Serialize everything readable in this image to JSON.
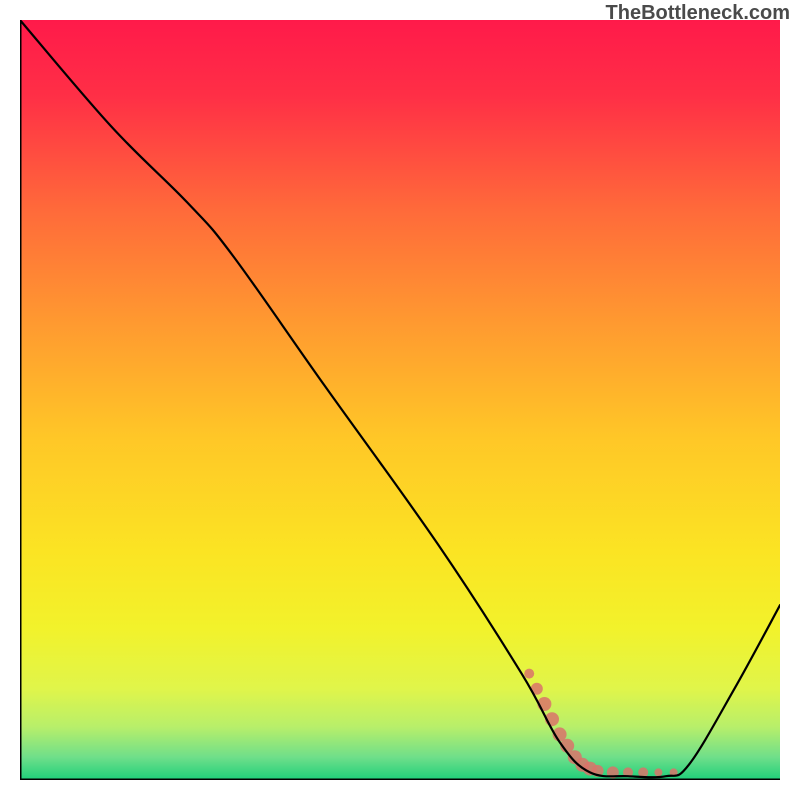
{
  "watermark": "TheBottleneck.com",
  "chart_data": {
    "type": "line",
    "title": "",
    "xlabel": "",
    "ylabel": "",
    "xlim": [
      0,
      100
    ],
    "ylim": [
      0,
      100
    ],
    "gradient_stops": [
      {
        "offset": 0.0,
        "color": "#ff1a4a"
      },
      {
        "offset": 0.1,
        "color": "#ff2f46"
      },
      {
        "offset": 0.25,
        "color": "#ff6a3a"
      },
      {
        "offset": 0.4,
        "color": "#ff9a30"
      },
      {
        "offset": 0.55,
        "color": "#ffc727"
      },
      {
        "offset": 0.7,
        "color": "#fbe423"
      },
      {
        "offset": 0.8,
        "color": "#f2f22b"
      },
      {
        "offset": 0.88,
        "color": "#e0f54a"
      },
      {
        "offset": 0.93,
        "color": "#b8ef6a"
      },
      {
        "offset": 0.97,
        "color": "#6fdf8a"
      },
      {
        "offset": 1.0,
        "color": "#1ecf7a"
      }
    ],
    "series": [
      {
        "name": "bottleneck-curve",
        "color": "#000000",
        "points": [
          {
            "x": 0,
            "y": 100
          },
          {
            "x": 12,
            "y": 86
          },
          {
            "x": 22,
            "y": 76
          },
          {
            "x": 28,
            "y": 69
          },
          {
            "x": 40,
            "y": 52
          },
          {
            "x": 55,
            "y": 31
          },
          {
            "x": 66,
            "y": 14
          },
          {
            "x": 71,
            "y": 5
          },
          {
            "x": 75,
            "y": 1
          },
          {
            "x": 80,
            "y": 0.5
          },
          {
            "x": 85,
            "y": 0.5
          },
          {
            "x": 88,
            "y": 2
          },
          {
            "x": 94,
            "y": 12
          },
          {
            "x": 100,
            "y": 23
          }
        ]
      }
    ],
    "scatter": {
      "name": "highlight-region",
      "color": "#d9736a",
      "points": [
        {
          "x": 67,
          "y": 14,
          "r": 5
        },
        {
          "x": 68,
          "y": 12,
          "r": 6
        },
        {
          "x": 69,
          "y": 10,
          "r": 7
        },
        {
          "x": 70,
          "y": 8,
          "r": 7
        },
        {
          "x": 71,
          "y": 6,
          "r": 7
        },
        {
          "x": 72,
          "y": 4.5,
          "r": 7
        },
        {
          "x": 73,
          "y": 3,
          "r": 7
        },
        {
          "x": 74,
          "y": 2,
          "r": 7
        },
        {
          "x": 75,
          "y": 1.5,
          "r": 7
        },
        {
          "x": 76,
          "y": 1.2,
          "r": 6
        },
        {
          "x": 78,
          "y": 1.0,
          "r": 6
        },
        {
          "x": 80,
          "y": 1.0,
          "r": 5
        },
        {
          "x": 82,
          "y": 1.0,
          "r": 5
        },
        {
          "x": 84,
          "y": 1.0,
          "r": 4
        },
        {
          "x": 86,
          "y": 1.0,
          "r": 4
        }
      ]
    }
  }
}
